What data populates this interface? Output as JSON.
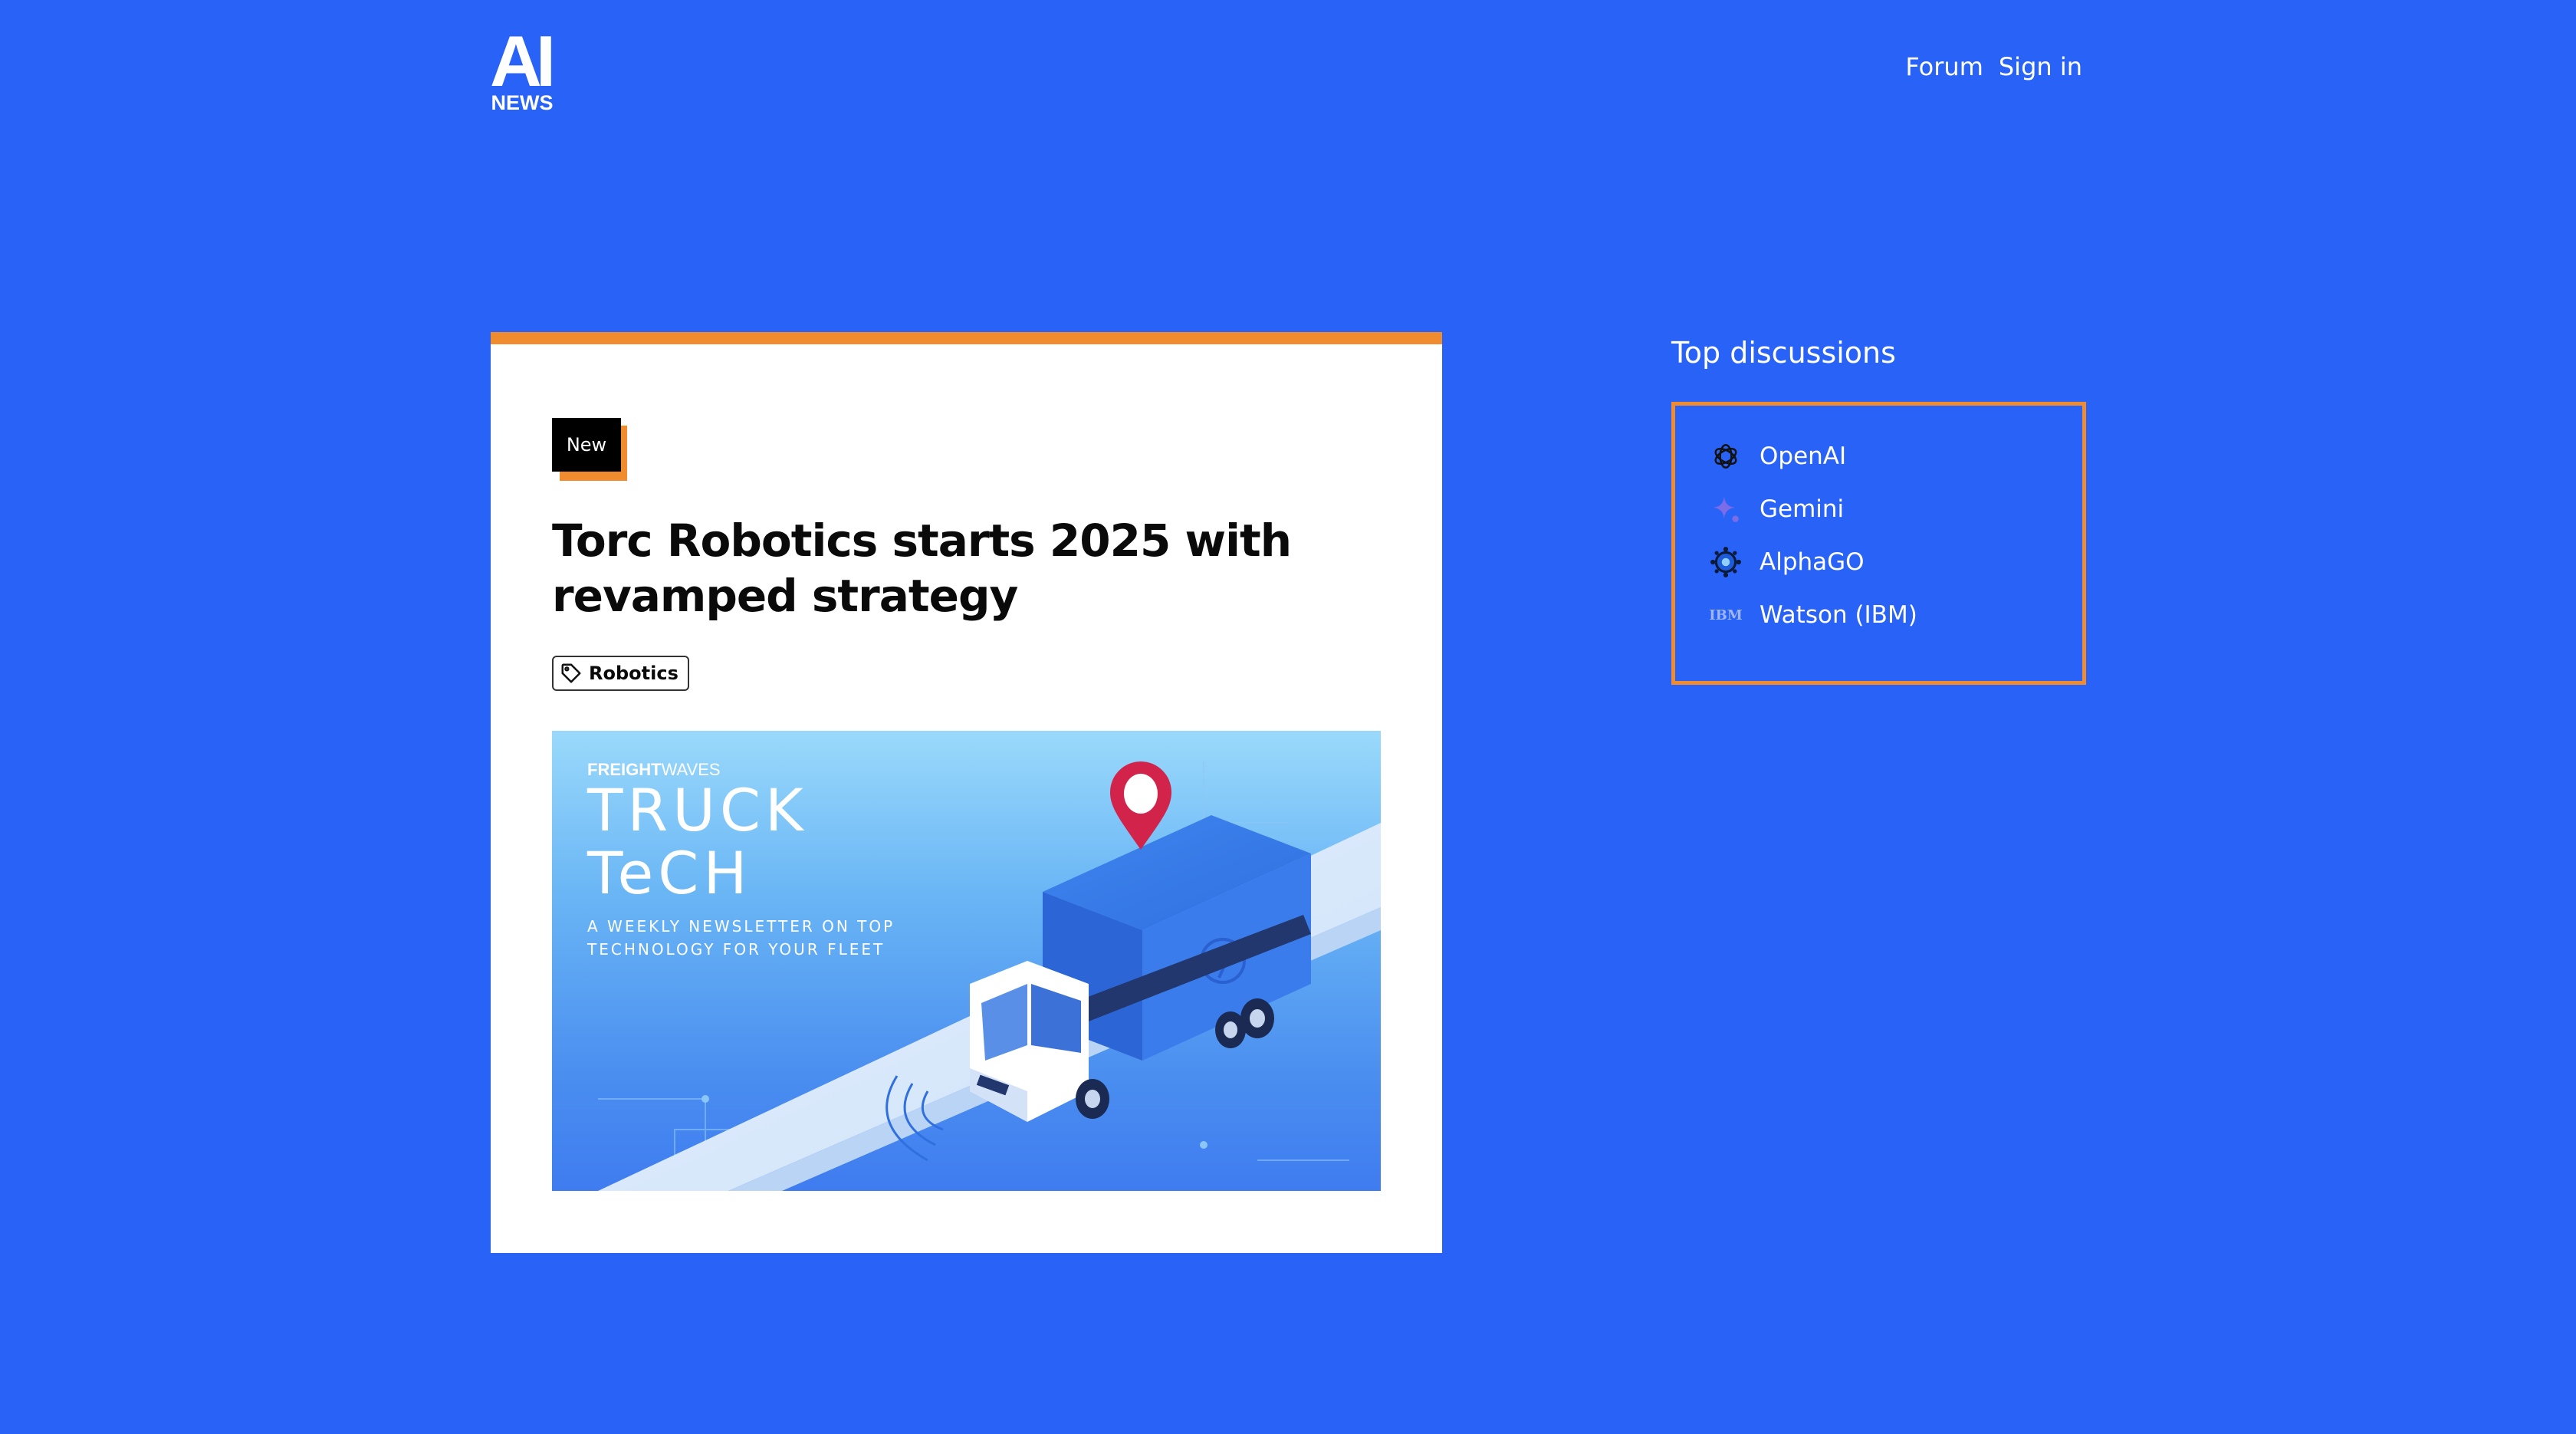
{
  "header": {
    "logo_top": "AI",
    "logo_bottom": "NEWS",
    "nav": [
      {
        "label": "Forum"
      },
      {
        "label": "Sign in"
      }
    ]
  },
  "article": {
    "badge": "New",
    "title": "Torc Robotics starts 2025 with revamped strategy",
    "tag": "Robotics",
    "hero": {
      "brand": "FREIGHTWAVES",
      "brand_bold": "FREIGHT",
      "brand_light": "WAVES",
      "title_line1": "TRUCK",
      "title_line2": "TeCH",
      "subtitle_line1": "A WEEKLY NEWSLETTER ON TOP",
      "subtitle_line2": "TECHNOLOGY FOR YOUR FLEET"
    }
  },
  "sidebar": {
    "title": "Top discussions",
    "items": [
      {
        "label": "OpenAI",
        "icon": "openai-icon"
      },
      {
        "label": "Gemini",
        "icon": "gemini-icon"
      },
      {
        "label": "AlphaGO",
        "icon": "alphago-icon"
      },
      {
        "label": "Watson (IBM)",
        "icon": "ibm-icon",
        "icon_text": "IBM"
      }
    ]
  },
  "colors": {
    "background": "#2962f6",
    "accent": "#f08b2e",
    "card": "#ffffff"
  }
}
